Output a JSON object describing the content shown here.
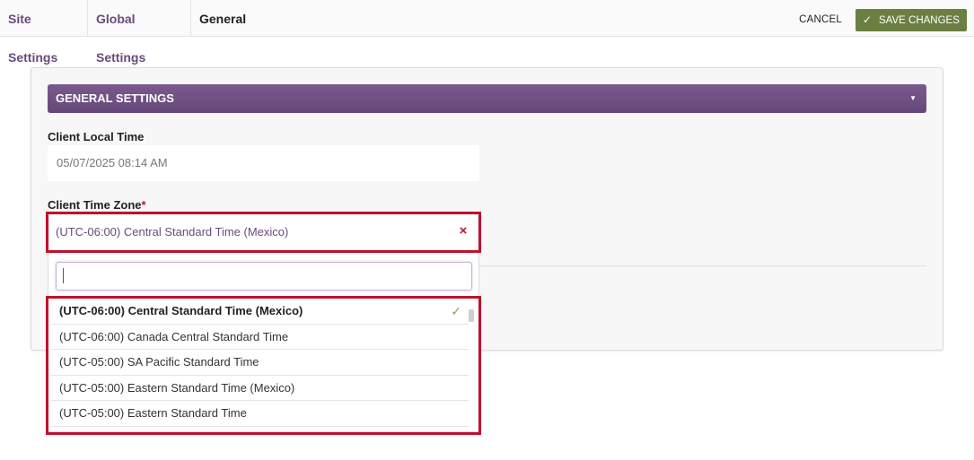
{
  "breadcrumb": {
    "items": [
      "Site Settings",
      "Global Settings"
    ],
    "current": "General"
  },
  "toolbar": {
    "cancel_label": "CANCEL",
    "save_label": "SAVE CHANGES"
  },
  "section": {
    "title": "GENERAL SETTINGS"
  },
  "fields": {
    "local_time": {
      "label": "Client Local Time",
      "value": "05/07/2025 08:14 AM"
    },
    "time_zone": {
      "label": "Client Time Zone",
      "required_marker": "*",
      "value": "(UTC-06:00) Central Standard Time (Mexico)",
      "search_value": "",
      "options": [
        "(UTC-06:00) Central Standard Time (Mexico)",
        "(UTC-06:00) Canada Central Standard Time",
        "(UTC-05:00) SA Pacific Standard Time",
        "(UTC-05:00) Eastern Standard Time (Mexico)",
        "(UTC-05:00) Eastern Standard Time"
      ],
      "selected_index": 0
    }
  },
  "colors": {
    "accent": "#6f4f82",
    "save": "#6b7f42",
    "highlight": "#c0112c"
  },
  "icons": {
    "section_toggle": "chevron-down-icon",
    "clear": "close-icon",
    "selected": "check-icon",
    "save": "check-icon"
  }
}
